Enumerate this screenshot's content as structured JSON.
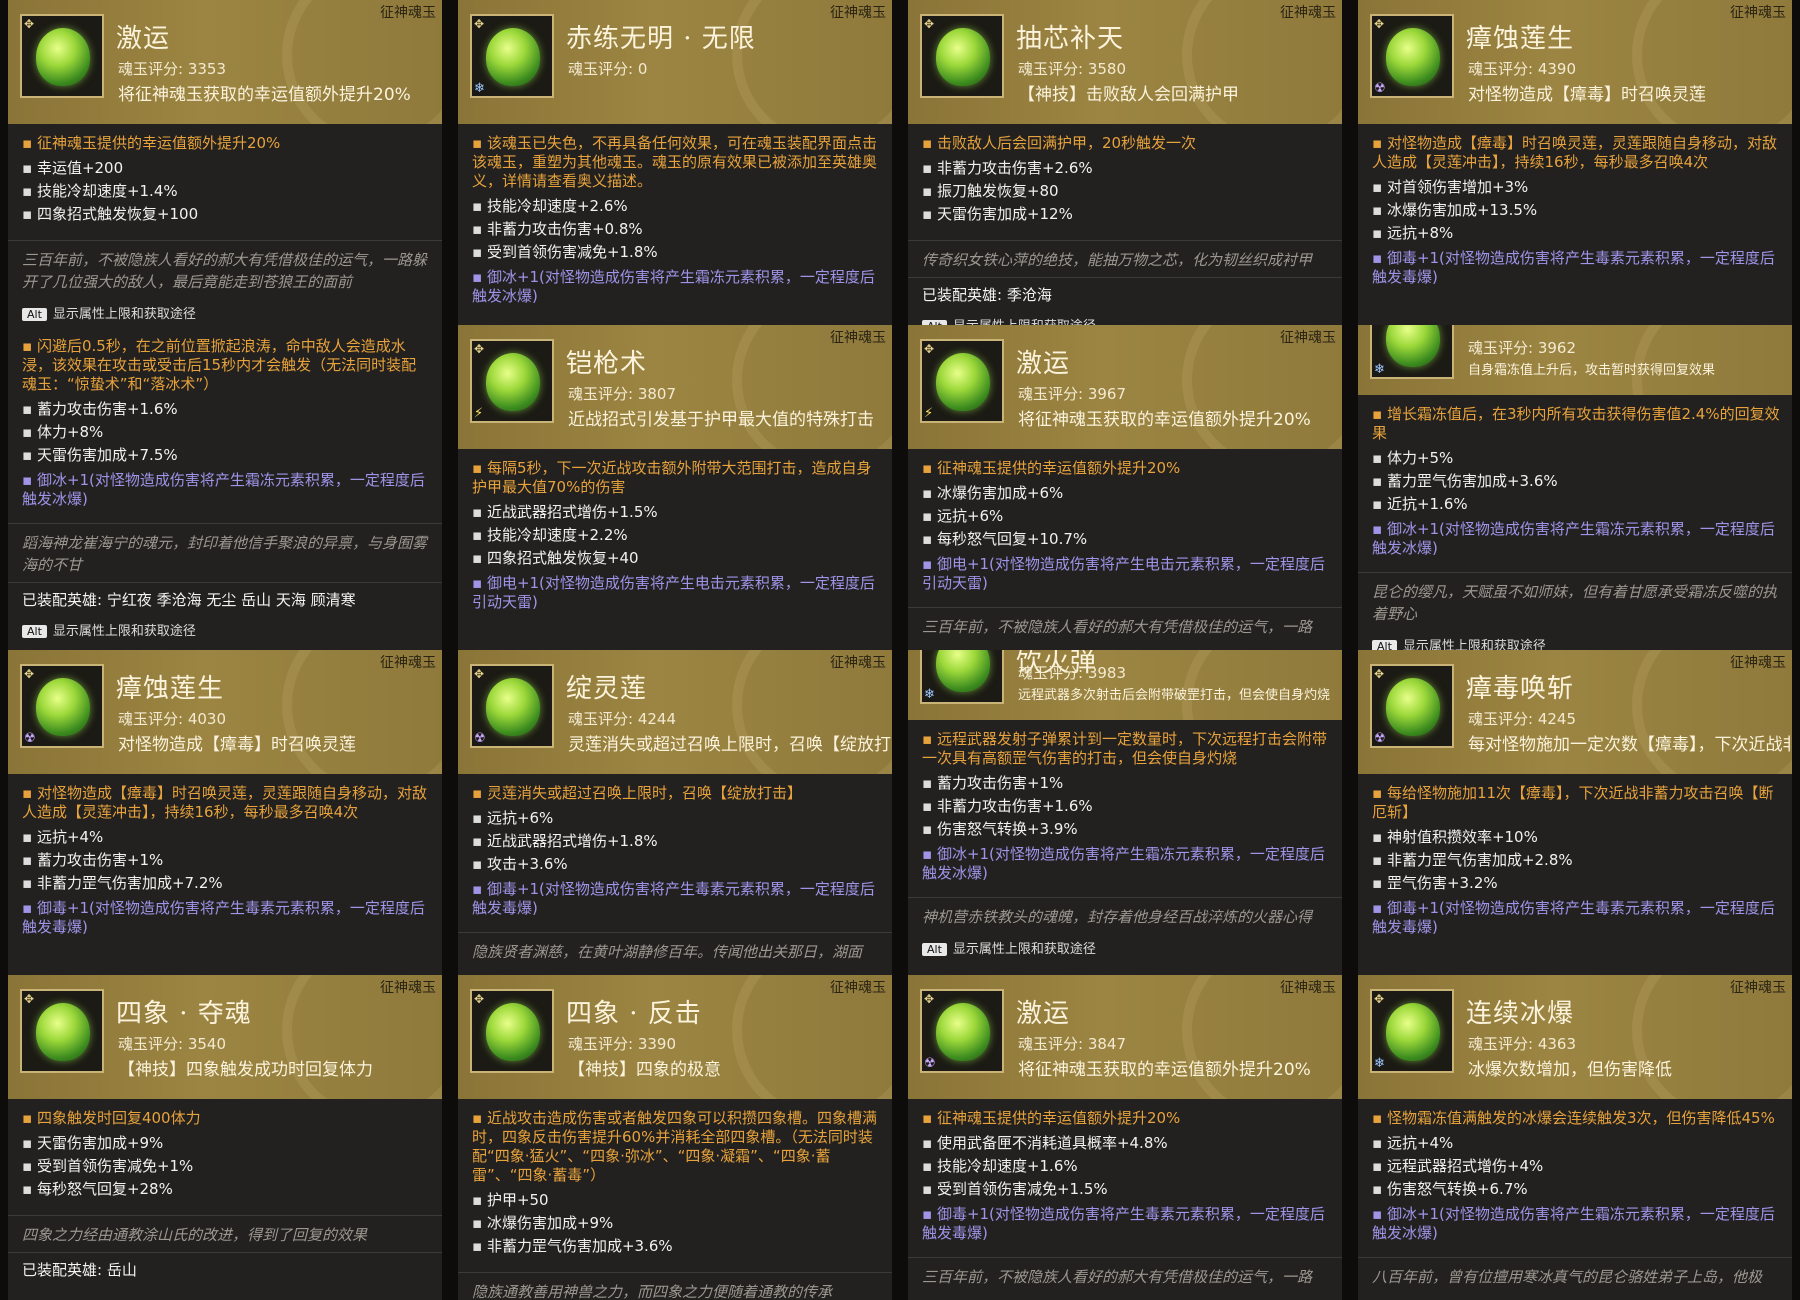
{
  "cards": [
    {
      "variant": "full",
      "tag": "征神魂玉",
      "name": "激运",
      "score": "魂玉评分: 3353",
      "desc": "将征神魂玉获取的幸运值额外提升20%",
      "elem": "",
      "orange": "征神魂玉提供的幸运值额外提升20%",
      "stats": [
        "幸运值+200",
        "技能冷却速度+1.4%",
        "四象招式触发恢复+100"
      ],
      "purple": "",
      "lore": "三百年前，不被隐族人看好的郝大有凭借极佳的运气，一路躲开了几位强大的敌人，最后竟能走到苍狼王的面前",
      "equipped": "",
      "alt": "显示属性上限和获取途径"
    },
    {
      "variant": "full",
      "tag": "征神魂玉",
      "name": "赤练无明 · 无限",
      "score": "魂玉评分: 0",
      "desc": "",
      "elem": "ice",
      "orange": "该魂玉已失色，不再具备任何效果，可在魂玉装配界面点击该魂玉，重塑为其他魂玉。魂玉的原有效果已被添加至英雄奥义，详情请查看奥义描述。",
      "stats": [
        "技能冷却速度+2.6%",
        "非蓄力攻击伤害+0.8%",
        "受到首领伤害减免+1.8%"
      ],
      "purple": "御冰+1(对怪物造成伤害将产生霜冻元素积累，一定程度后触发冰爆)",
      "lore": "",
      "equipped": "",
      "alt": ""
    },
    {
      "variant": "full",
      "tag": "征神魂玉",
      "name": "抽芯补天",
      "score": "魂玉评分: 3580",
      "desc": "【神技】击败敌人会回满护甲",
      "elem": "",
      "orange": "击败敌人后会回满护甲，20秒触发一次",
      "stats": [
        "非蓄力攻击伤害+2.6%",
        "振刀触发恢复+80",
        "天雷伤害加成+12%"
      ],
      "purple": "",
      "lore": "传奇织女铁心萍的绝技，能抽万物之芯，化为韧丝织成衬甲",
      "equipped": "已装配英雄: 季沧海",
      "alt": "显示属性上限和获取途径"
    },
    {
      "variant": "full",
      "tag": "征神魂玉",
      "name": "瘴蚀莲生",
      "score": "魂玉评分: 4390",
      "desc": "对怪物造成【瘴毒】时召唤灵莲",
      "elem": "poison",
      "orange": "对怪物造成【瘴毒】时召唤灵莲，灵莲跟随自身移动，对敌人造成【灵莲冲击】，持续16秒，每秒最多召唤4次",
      "stats": [
        "对首领伤害增加+3%",
        "冰爆伤害加成+13.5%",
        "远抗+8%"
      ],
      "purple": "御毒+1(对怪物造成伤害将产生毒素元素积累，一定程度后触发毒爆)",
      "lore": "",
      "equipped": "",
      "alt": ""
    },
    {
      "variant": "noheader",
      "tag": "",
      "name": "",
      "score": "",
      "desc": "",
      "elem": "",
      "orange": "闪避后0.5秒，在之前位置掀起浪涛，命中敌人会造成水浸，该效果在攻击或受击后15秒内才会触发（无法同时装配魂玉：“惊蛰术”和“落冰术”）",
      "stats": [
        "蓄力攻击伤害+1.6%",
        "体力+8%",
        "天雷伤害加成+7.5%"
      ],
      "purple": "御冰+1(对怪物造成伤害将产生霜冻元素积累，一定程度后触发冰爆)",
      "lore": "蹈海神龙崔海宁的魂元，封印着他信手聚浪的异禀，与身囿雾海的不甘",
      "equipped": "已装配英雄: 宁红夜 季沧海 无尘 岳山 天海 顾清寒",
      "alt": "显示属性上限和获取途径"
    },
    {
      "variant": "full",
      "tag": "征神魂玉",
      "name": "铠枪术",
      "score": "魂玉评分: 3807",
      "desc": "近战招式引发基于护甲最大值的特殊打击",
      "elem": "thunder",
      "orange": "每隔5秒，下一次近战攻击额外附带大范围打击，造成自身护甲最大值70%的伤害",
      "stats": [
        "近战武器招式增伤+1.5%",
        "技能冷却速度+2.2%",
        "四象招式触发恢复+40"
      ],
      "purple": "御电+1(对怪物造成伤害将产生电击元素积累，一定程度后引动天雷)",
      "lore": "",
      "equipped": "",
      "alt": ""
    },
    {
      "variant": "full",
      "tag": "征神魂玉",
      "name": "激运",
      "score": "魂玉评分: 3967",
      "desc": "将征神魂玉获取的幸运值额外提升20%",
      "elem": "thunder",
      "orange": "征神魂玉提供的幸运值额外提升20%",
      "stats": [
        "冰爆伤害加成+6%",
        "远抗+6%",
        "每秒怒气回复+10.7%"
      ],
      "purple": "御电+1(对怪物造成伤害将产生电击元素积累，一定程度后引动天雷)",
      "lore": "三百年前，不被隐族人看好的郝大有凭借极佳的运气，一路",
      "equipped": "",
      "alt": ""
    },
    {
      "variant": "partial",
      "tag": "",
      "name": "",
      "score": "魂玉评分: 3962",
      "desc": "自身霜冻值上升后，攻击暂时获得回复效果",
      "elem": "ice",
      "orange": "增长霜冻值后，在3秒内所有攻击获得伤害值2.4%的回复效果",
      "stats": [
        "体力+5%",
        "蓄力罡气伤害加成+3.6%",
        "近抗+1.6%"
      ],
      "purple": "御冰+1(对怪物造成伤害将产生霜冻元素积累，一定程度后触发冰爆)",
      "lore": "昆仑的缨凡，天赋虽不如师妹，但有着甘愿承受霜冻反噬的执着野心",
      "equipped": "",
      "alt": "显示属性上限和获取途径"
    },
    {
      "variant": "full",
      "tag": "征神魂玉",
      "name": "瘴蚀莲生",
      "score": "魂玉评分: 4030",
      "desc": "对怪物造成【瘴毒】时召唤灵莲",
      "elem": "poison",
      "orange": "对怪物造成【瘴毒】时召唤灵莲，灵莲跟随自身移动，对敌人造成【灵莲冲击】，持续16秒，每秒最多召唤4次",
      "stats": [
        "远抗+4%",
        "蓄力攻击伤害+1%",
        "非蓄力罡气伤害加成+7.2%"
      ],
      "purple": "御毒+1(对怪物造成伤害将产生毒素元素积累，一定程度后触发毒爆)",
      "lore": "",
      "equipped": "",
      "alt": ""
    },
    {
      "variant": "full",
      "tag": "征神魂玉",
      "name": "绽灵莲",
      "score": "魂玉评分: 4244",
      "desc": "灵莲消失或超过召唤上限时，召唤【绽放打击】",
      "elem": "poison",
      "orange": "灵莲消失或超过召唤上限时，召唤【绽放打击】",
      "stats": [
        "远抗+6%",
        "近战武器招式增伤+1.8%",
        "攻击+3.6%"
      ],
      "purple": "御毒+1(对怪物造成伤害将产生毒素元素积累，一定程度后触发毒爆)",
      "lore": "隐族贤者渊慈，在黄叶湖静修百年。传闻他出关那日，湖面",
      "equipped": "",
      "alt": ""
    },
    {
      "variant": "partial",
      "tag": "",
      "name": "饮火弹",
      "score": "魂玉评分: 3983",
      "desc": "远程武器多次射击后会附带破罡打击，但会使自身灼烧",
      "elem": "ice",
      "orange": "远程武器发射子弹累计到一定数量时，下次远程打击会附带一次具有高额罡气伤害的打击，但会使自身灼烧",
      "stats": [
        "蓄力攻击伤害+1%",
        "非蓄力攻击伤害+1.6%",
        "伤害怒气转换+3.9%"
      ],
      "purple": "御冰+1(对怪物造成伤害将产生霜冻元素积累，一定程度后触发冰爆)",
      "lore": "神机营赤铁教头的魂魄，封存着他身经百战淬炼的火器心得",
      "equipped": "",
      "alt": "显示属性上限和获取途径"
    },
    {
      "variant": "full",
      "tag": "征神魂玉",
      "name": "瘴毒唤斩",
      "score": "魂玉评分: 4245",
      "desc": "每对怪物施加一定次数【瘴毒】，下次近战非蓄力攻击召唤【断厄斩】",
      "elem": "poison",
      "orange": "每给怪物施加11次【瘴毒】，下次近战非蓄力攻击召唤【断厄斩】",
      "stats": [
        "神射值积攒效率+10%",
        "非蓄力罡气伤害加成+2.8%",
        "罡气伤害+3.2%"
      ],
      "purple": "御毒+1(对怪物造成伤害将产生毒素元素积累，一定程度后触发毒爆)",
      "lore": "",
      "equipped": "",
      "alt": ""
    },
    {
      "variant": "full",
      "tag": "征神魂玉",
      "name": "四象 · 夺魂",
      "score": "魂玉评分: 3540",
      "desc": "【神技】四象触发成功时回复体力",
      "elem": "",
      "orange": "四象触发时回复400体力",
      "stats": [
        "天雷伤害加成+9%",
        "受到首领伤害减免+1%",
        "每秒怒气回复+28%"
      ],
      "purple": "",
      "lore": "四象之力经由通教涂山氏的改进，得到了回复的效果",
      "equipped": "已装配英雄: 岳山",
      "alt": ""
    },
    {
      "variant": "full",
      "tag": "征神魂玉",
      "name": "四象 · 反击",
      "score": "魂玉评分: 3390",
      "desc": "【神技】四象的极意",
      "elem": "",
      "orange": "近战攻击造成伤害或者触发四象可以积攒四象槽。四象槽满时，四象反击伤害提升60%并消耗全部四象槽。（无法同时装配“四象·猛火”、“四象·弥冰”、“四象·凝霜”、“四象·蓄雷”、“四象·蓄毒”）",
      "stats": [
        "护甲+50",
        "冰爆伤害加成+9%",
        "非蓄力罡气伤害加成+3.6%"
      ],
      "purple": "",
      "lore": "隐族通教善用神兽之力，而四象之力便随着通教的传承",
      "equipped": "",
      "alt": ""
    },
    {
      "variant": "full",
      "tag": "征神魂玉",
      "name": "激运",
      "score": "魂玉评分: 3847",
      "desc": "将征神魂玉获取的幸运值额外提升20%",
      "elem": "poison",
      "orange": "征神魂玉提供的幸运值额外提升20%",
      "stats": [
        "使用武备匣不消耗道具概率+4.8%",
        "技能冷却速度+1.6%",
        "受到首领伤害减免+1.5%"
      ],
      "purple": "御毒+1(对怪物造成伤害将产生毒素元素积累，一定程度后触发毒爆)",
      "lore": "三百年前，不被隐族人看好的郝大有凭借极佳的运气，一路",
      "equipped": "",
      "alt": ""
    },
    {
      "variant": "full",
      "tag": "征神魂玉",
      "name": "连续冰爆",
      "score": "魂玉评分: 4363",
      "desc": "冰爆次数增加，但伤害降低",
      "elem": "ice",
      "orange": "怪物霜冻值满触发的冰爆会连续触发3次，但伤害降低45%",
      "stats": [
        "远抗+4%",
        "远程武器招式增伤+4%",
        "伤害怒气转换+6.7%"
      ],
      "purple": "御冰+1(对怪物造成伤害将产生霜冻元素积累，一定程度后触发冰爆)",
      "lore": "八百年前，曾有位擅用寒冰真气的昆仑骆姓弟子上岛，他极",
      "equipped": "",
      "alt": ""
    }
  ],
  "colors": {
    "header": "#9c8542",
    "panel": "#222120",
    "effect": "#e7a23c",
    "element": "#9f94e8",
    "lore": "#9c9890"
  },
  "alt_key": "Alt"
}
